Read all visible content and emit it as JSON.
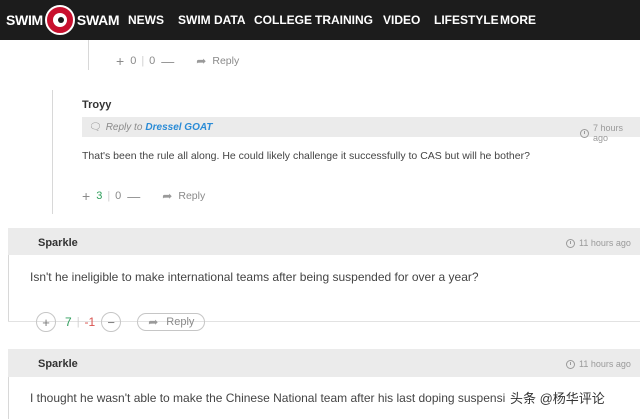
{
  "nav": {
    "logo_left": "SWIM",
    "logo_right": "SWAM",
    "items": [
      "NEWS",
      "SWIM DATA",
      "COLLEGE",
      "TRAINING",
      "VIDEO",
      "LIFESTYLE",
      "MORE"
    ]
  },
  "comment0": {
    "up": "0",
    "down": "0",
    "reply": "Reply"
  },
  "comment1": {
    "author": "Troyy",
    "reply_to_prefix": "Reply to",
    "reply_to_name": "Dressel GOAT",
    "time": "7 hours ago",
    "text": "That's been the rule all along. He could likely challenge it successfully to CAS but will he bother?",
    "up": "3",
    "down": "0",
    "reply": "Reply"
  },
  "comment2": {
    "author": "Sparkle",
    "time": "11 hours ago",
    "text": "Isn't he ineligible to make international teams after being suspended for over a year?",
    "up": "7",
    "down": "-1",
    "reply": "Reply"
  },
  "comment3": {
    "author": "Sparkle",
    "time": "11 hours ago",
    "text": "I thought he wasn't able to make the Chinese National team after his last doping suspensi"
  },
  "watermark": "头条 @杨华评论",
  "colors": {
    "nav_bg": "#1c1c1c",
    "upvote_green": "#2e9e5b",
    "downvote_red": "#d9534f",
    "link_blue": "#2a8bd6"
  }
}
